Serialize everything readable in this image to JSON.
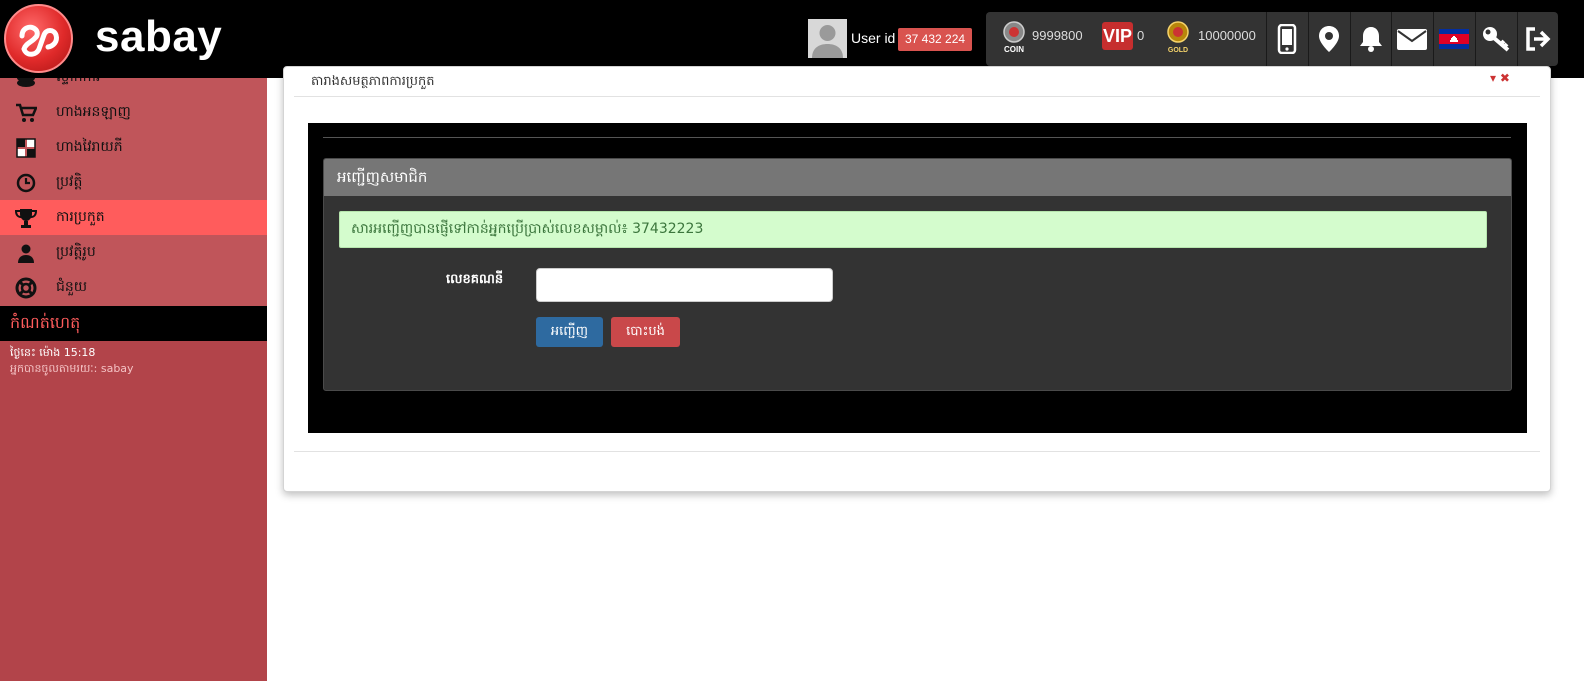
{
  "header": {
    "brand": "sabay",
    "user_id_label": "User id",
    "user_id_value": "37 432 224",
    "wallet": {
      "coin_label": "COIN",
      "coin_value": "9999800",
      "vip_label": "VIP",
      "vip_value": "0",
      "gold_label": "GOLD",
      "gold_value": "10000000"
    }
  },
  "sidebar": {
    "items": [
      {
        "label": "ស្ទាក់ការ"
      },
      {
        "label": "ហាងអនឡាញ"
      },
      {
        "label": "ហាងវៃរាយភី"
      },
      {
        "label": "ប្រវត្តិ"
      },
      {
        "label": "ការប្រកួត"
      },
      {
        "label": "ប្រវត្តិរូប"
      },
      {
        "label": "ជំនួយ"
      }
    ],
    "notes_title": "កំណត់ហេតុ",
    "note_time": "ថ្ងៃនេះ ម៉ោង 15:18",
    "note_text": "អ្នកបានចូលតាមរយៈ: sabay"
  },
  "main": {
    "card_title": "តារាងសមត្ថភាពការប្រកួត",
    "panel_title": "អញ្ជើញសមាជិក",
    "alert_text": "សារអញ្ជើញបានផ្ញើទៅកាន់អ្នកប្រើប្រាស់លេខសម្គាល់៖ 37432223",
    "field_label": "លេខគណនី",
    "field_value": "",
    "invite_button": "អញ្ជើញ",
    "cancel_button": "បោះបង់"
  },
  "colors": {
    "sidebar": "#b2444a",
    "menu": "#c0555a",
    "active": "#ff5c5c",
    "primary": "#2e6aa0",
    "danger": "#c9484a",
    "alert_bg": "#d4fccd"
  }
}
